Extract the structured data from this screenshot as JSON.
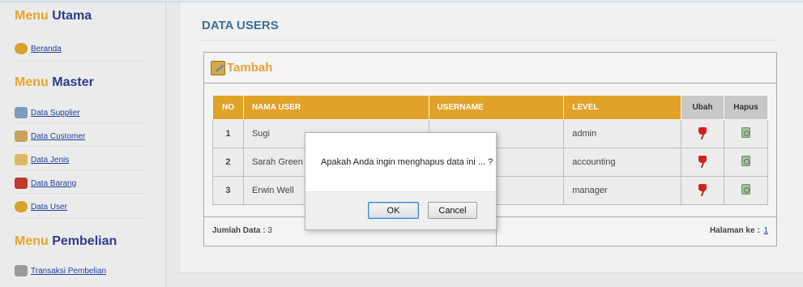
{
  "sidebar": {
    "sections": [
      {
        "title_a": "Menu",
        "title_b": "Utama",
        "items": [
          {
            "label": "Beranda",
            "icon": "home-icon"
          }
        ]
      },
      {
        "title_a": "Menu",
        "title_b": "Master",
        "items": [
          {
            "label": "Data Supplier",
            "icon": "supplier-icon"
          },
          {
            "label": "Data Customer",
            "icon": "customer-icon"
          },
          {
            "label": "Data Jenis",
            "icon": "category-icon"
          },
          {
            "label": "Data Barang",
            "icon": "box-icon"
          },
          {
            "label": "Data User",
            "icon": "users-icon"
          }
        ]
      },
      {
        "title_a": "Menu",
        "title_b": "Pembelian",
        "items": [
          {
            "label": "Transaksi Pembelian",
            "icon": "cart-icon"
          }
        ]
      }
    ]
  },
  "main": {
    "title": "DATA USERS",
    "panel_title": "Tambah",
    "columns": [
      "NO",
      "NAMA USER",
      "USERNAME",
      "LEVEL",
      "Ubah",
      "Hapus"
    ],
    "rows": [
      {
        "no": "1",
        "nama": "Sugi",
        "username": "",
        "level": "admin"
      },
      {
        "no": "2",
        "nama": "Sarah Green",
        "username": "",
        "level": "accounting"
      },
      {
        "no": "3",
        "nama": "Erwin Well",
        "username": "",
        "level": "manager"
      }
    ],
    "footer": {
      "count_label": "Jumlah Data :",
      "count_value": "3",
      "page_label": "Halaman ke :",
      "page_value": "1"
    }
  },
  "dialog": {
    "message": "Apakah Anda ingin menghapus data ini ... ?",
    "ok": "OK",
    "cancel": "Cancel"
  },
  "colors": {
    "accent": "#e1a229",
    "title_blue": "#3c6f99",
    "menu_navy": "#2c3c8e",
    "link": "#1f3f9c"
  }
}
